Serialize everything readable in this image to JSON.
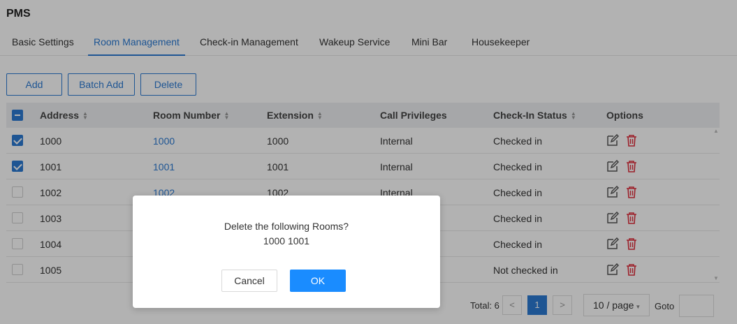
{
  "app": {
    "title": "PMS"
  },
  "tabs": [
    {
      "label": "Basic Settings",
      "active": false
    },
    {
      "label": "Room Management",
      "active": true
    },
    {
      "label": "Check-in Management",
      "active": false
    },
    {
      "label": "Wakeup Service",
      "active": false
    },
    {
      "label": "Mini Bar",
      "active": false
    },
    {
      "label": "Housekeeper",
      "active": false
    }
  ],
  "toolbar": {
    "add_label": "Add",
    "batch_add_label": "Batch Add",
    "delete_label": "Delete"
  },
  "table": {
    "columns": [
      "Address",
      "Room Number",
      "Extension",
      "Call Privileges",
      "Check-In Status",
      "Options"
    ],
    "rows": [
      {
        "checked": true,
        "address": "1000",
        "room": "1000",
        "extension": "1000",
        "privileges": "Internal",
        "status": "Checked in"
      },
      {
        "checked": true,
        "address": "1001",
        "room": "1001",
        "extension": "1001",
        "privileges": "Internal",
        "status": "Checked in"
      },
      {
        "checked": false,
        "address": "1002",
        "room": "1002",
        "extension": "1002",
        "privileges": "Internal",
        "status": "Checked in"
      },
      {
        "checked": false,
        "address": "1003",
        "room": "",
        "extension": "",
        "privileges": "",
        "status": "Checked in"
      },
      {
        "checked": false,
        "address": "1004",
        "room": "",
        "extension": "",
        "privileges": "",
        "status": "Checked in"
      },
      {
        "checked": false,
        "address": "1005",
        "room": "",
        "extension": "",
        "privileges": "",
        "status": "Not checked in"
      }
    ]
  },
  "pagination": {
    "total_label": "Total: 6",
    "prev": "<",
    "current_page": "1",
    "next": ">",
    "page_size": "10 / page",
    "goto_label": "Goto"
  },
  "modal": {
    "message_line1": "Delete the following Rooms?",
    "message_line2": "1000 1001",
    "cancel_label": "Cancel",
    "ok_label": "OK"
  },
  "colors": {
    "accent": "#2b7ad3",
    "danger": "#e0303e",
    "ok_button": "#1a8cff"
  }
}
